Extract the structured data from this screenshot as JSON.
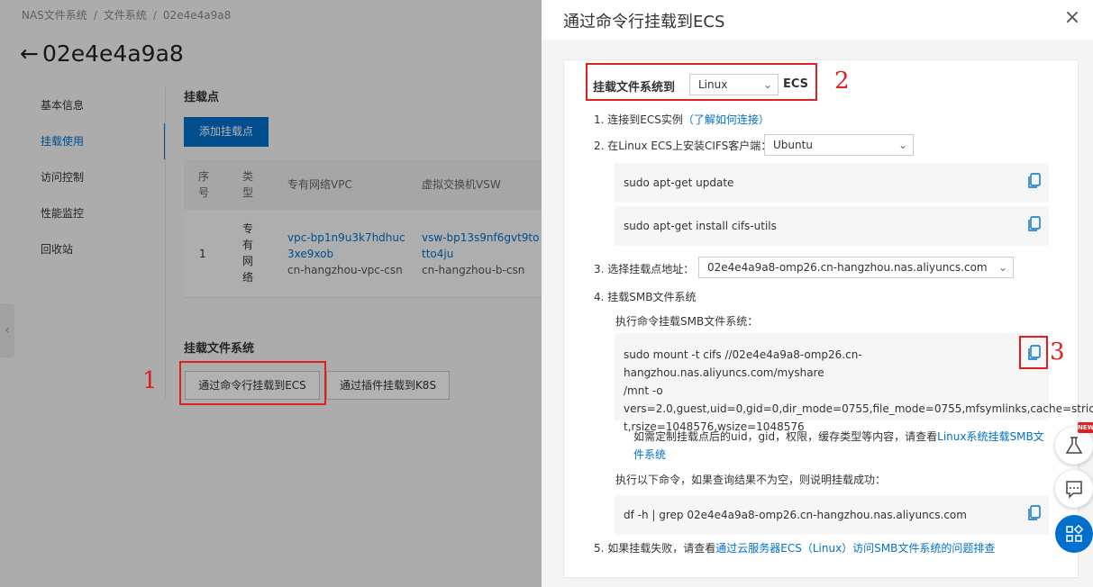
{
  "breadcrumb": {
    "items": [
      "NAS文件系统",
      "文件系统",
      "02e4e4a9a8"
    ],
    "sep": "/"
  },
  "page": {
    "back_glyph": "←",
    "title": "02e4e4a9a8"
  },
  "sidebar": {
    "items": [
      {
        "label": "基本信息",
        "active": false
      },
      {
        "label": "挂载使用",
        "active": true
      },
      {
        "label": "访问控制",
        "active": false
      },
      {
        "label": "性能监控",
        "active": false
      },
      {
        "label": "回收站",
        "active": false
      }
    ]
  },
  "mount_points": {
    "title": "挂载点",
    "add_button": "添加挂载点",
    "headers": {
      "index": [
        "序",
        "号"
      ],
      "type": [
        "类",
        "型"
      ],
      "vpc": "专有网络VPC",
      "vsw": "虚拟交换机VSW"
    },
    "row": {
      "index": "1",
      "type": [
        "专",
        "有",
        "网",
        "络"
      ],
      "vpc_id": [
        "vpc-bp1n9u3k7hdhuc",
        "3xe9xob"
      ],
      "vpc_name": "cn-hangzhou-vpc-csn",
      "vsw_id": [
        "vsw-bp13s9nf6gvt9to",
        "tto4ju"
      ],
      "vsw_name": "cn-hangzhou-b-csn"
    }
  },
  "mount_fs": {
    "title": "挂载文件系统",
    "cmd_button": "通过命令行挂载到ECS",
    "plugin_button": "通过插件挂载到K8S"
  },
  "drawer": {
    "title": "通过命令行挂载到ECS",
    "close_glyph": "×",
    "mount_to_label": "挂载文件系统到",
    "os_select": "Linux",
    "ecs_suffix": "ECS",
    "step1_text": "1. 连接到ECS实例",
    "step1_link": "（了解如何连接）",
    "step2_text": "2. 在Linux ECS上安装CIFS客户端：",
    "distro_select": "Ubuntu",
    "cmd_update": "sudo apt-get update",
    "cmd_install": "sudo apt-get install cifs-utils",
    "step3_text": "3. 选择挂载点地址：",
    "mount_point_select": "02e4e4a9a8-omp26.cn-hangzhou.nas.aliyuncs.com",
    "step4_text": "4. 挂载SMB文件系统",
    "exec_mount_label": "执行命令挂载SMB文件系统：",
    "mount_cmd": [
      "sudo mount -t cifs //02e4e4a9a8-omp26.cn-hangzhou.nas.aliyuncs.com/myshare",
      "/mnt -o",
      "vers=2.0,guest,uid=0,gid=0,dir_mode=0755,file_mode=0755,mfsymlinks,cache=stric",
      "t,rsize=1048576,wsize=1048576"
    ],
    "custom_note": "如需定制挂载点后的uid，gid，权限，缓存类型等内容，请查看",
    "custom_link": "Linux系统挂载SMB文件系统",
    "verify_label": "执行以下命令，如果查询结果不为空，则说明挂载成功：",
    "verify_cmd": "df -h | grep 02e4e4a9a8-omp26.cn-hangzhou.nas.aliyuncs.com",
    "step5_text": "5. 如果挂载失败，请查看",
    "step5_link": "通过云服务器ECS（Linux）访问SMB文件系统的问题排查"
  },
  "annotations": [
    "1",
    "2",
    "3"
  ],
  "float_rail": {
    "badge": "NEW"
  },
  "colors": {
    "accent": "#0070cc",
    "annotation": "#e02020"
  }
}
